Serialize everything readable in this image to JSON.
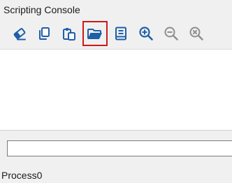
{
  "window": {
    "title": "Scripting Console"
  },
  "toolbar": {
    "buttons": [
      {
        "icon": "eraser-icon"
      },
      {
        "icon": "copy-icon"
      },
      {
        "icon": "paste-icon"
      },
      {
        "icon": "open-folder-icon",
        "highlighted": true
      },
      {
        "icon": "book-icon"
      },
      {
        "icon": "zoom-in-icon"
      },
      {
        "icon": "zoom-out-icon"
      },
      {
        "icon": "zoom-reset-icon"
      }
    ]
  },
  "console": {
    "output": ""
  },
  "command_input": {
    "value": "",
    "placeholder": ""
  },
  "status": {
    "process": "Process0"
  },
  "colors": {
    "accent": "#1f5fa8",
    "highlight_border": "#cc1a1a",
    "disabled_icon": "#8e8e8e",
    "background": "#f0f0f0"
  }
}
